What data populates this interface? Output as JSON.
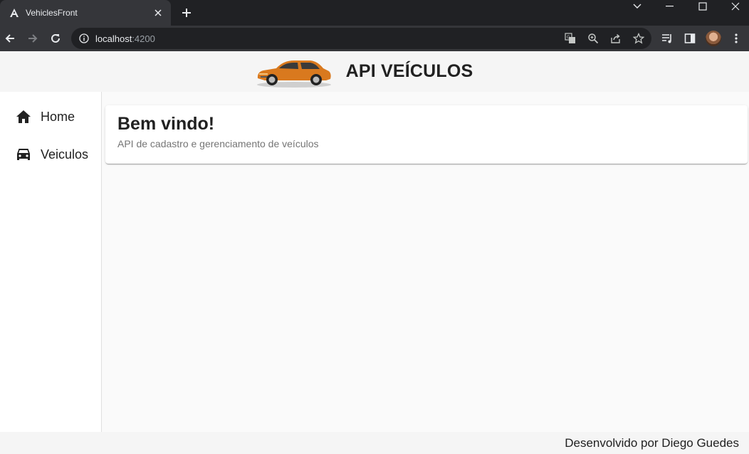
{
  "browser": {
    "tab_title": "VehiclesFront",
    "url_host": "localhost",
    "url_port": ":4200"
  },
  "app": {
    "title": "API VEÍCULOS",
    "logo_icon": "car-logo"
  },
  "sidenav": {
    "items": [
      {
        "label": "Home",
        "icon": "home-icon"
      },
      {
        "label": "Veiculos",
        "icon": "car-icon"
      }
    ]
  },
  "main": {
    "card_title": "Bem vindo!",
    "card_subtitle": "API de cadastro e gerenciamento de veículos"
  },
  "footer": {
    "text": "Desenvolvido por Diego Guedes"
  },
  "colors": {
    "car_orange": "#d9791e",
    "chrome_dark": "#202124",
    "chrome_toolbar": "#35363a"
  }
}
